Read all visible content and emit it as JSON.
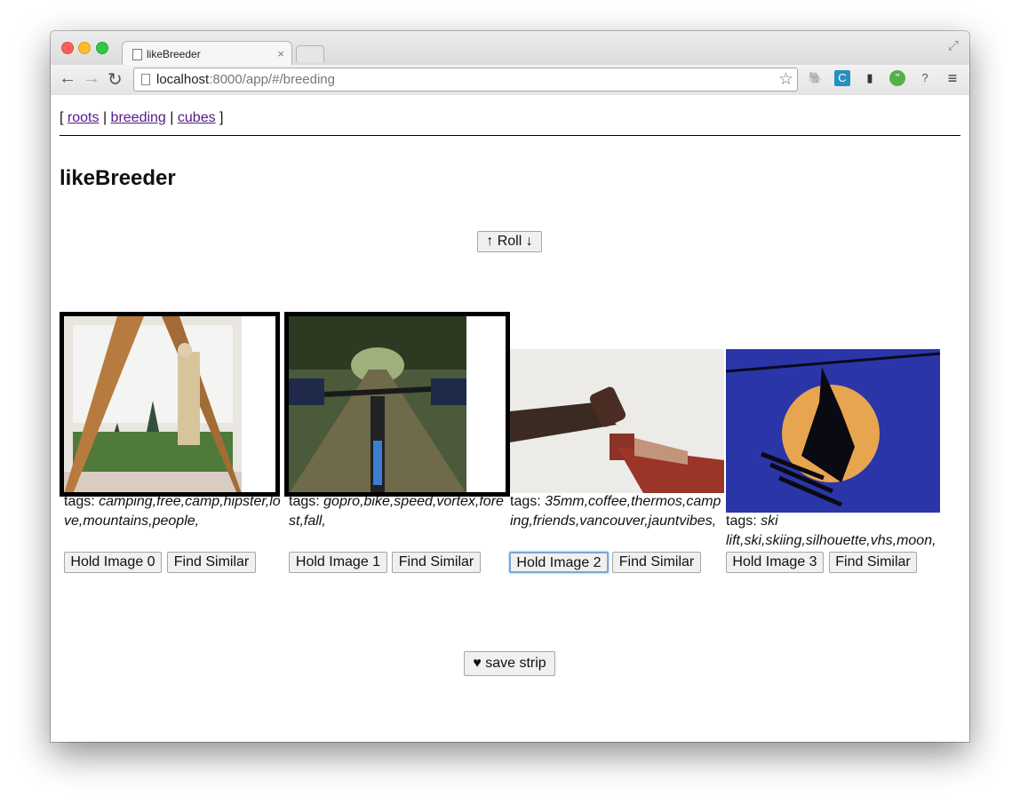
{
  "browser": {
    "tab_title": "likeBreeder",
    "tab_close": "×",
    "url_host": "localhost",
    "url_rest": ":8000/app/#/breeding",
    "nav": {
      "back": "←",
      "forward": "→",
      "reload": "↻"
    },
    "star": "☆",
    "menu": "≡"
  },
  "nav": {
    "open": "[",
    "sep": "|",
    "close": "]",
    "links": [
      "roots",
      "breeding",
      "cubes"
    ]
  },
  "page_title": "likeBreeder",
  "roll_button": "↑ Roll ↓",
  "tags_label": "tags:",
  "cards": [
    {
      "tags": "camping,free,camp,hipster,love,mountains,people,",
      "hold": "Hold Image 0",
      "similar": "Find Similar",
      "held": true
    },
    {
      "tags": "gopro,bike,speed,vortex,forest,fall,",
      "hold": "Hold Image 1",
      "similar": "Find Similar",
      "held": true
    },
    {
      "tags": "35mm,coffee,thermos,camping,friends,vancouver,jauntvibes,",
      "hold": "Hold Image 2",
      "similar": "Find Similar",
      "held": false
    },
    {
      "tags": "ski lift,ski,skiing,silhouette,vhs,moon,",
      "hold": "Hold Image 3",
      "similar": "Find Similar",
      "held": false
    }
  ],
  "save_button": "save strip",
  "save_icon": "heart-icon"
}
